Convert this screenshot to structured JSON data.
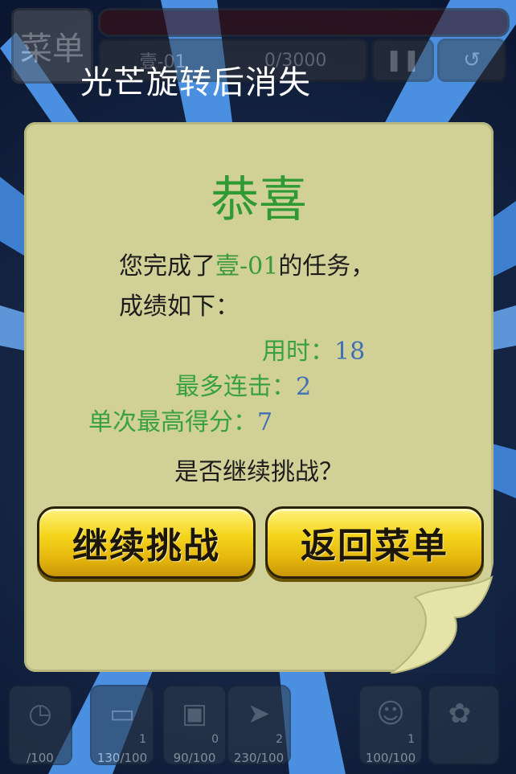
{
  "caption": "光芒旋转后消失",
  "hud": {
    "menu_label": "菜单",
    "level": "壹-01",
    "progress": "0/3000",
    "pause_icon": "pause-icon",
    "restart_icon": "restart-icon",
    "sound_icon": "sound-icon"
  },
  "dialog": {
    "title": "恭喜",
    "line1_prefix": "您完成了",
    "level_name": "壹-01",
    "line1_suffix": "的任务，",
    "line2": "成绩如下：",
    "stats": [
      {
        "label": "用时：",
        "value": "18"
      },
      {
        "label": "最多连击：",
        "value": "2"
      },
      {
        "label": "单次最高得分：",
        "value": "7"
      }
    ],
    "question": "是否继续挑战？",
    "continue_label": "继续挑战",
    "menu_label": "返回菜单"
  },
  "items": [
    {
      "icon": "clock-icon",
      "count": "",
      "caption": "/100"
    },
    {
      "icon": "cassette-icon",
      "count": "1",
      "caption": "130/100"
    },
    {
      "icon": "tv-icon",
      "count": "0",
      "caption": "90/100"
    },
    {
      "icon": "paper-plane-icon",
      "count": "2",
      "caption": "230/100"
    },
    {
      "icon": "mascot-icon",
      "count": "1",
      "caption": "100/100"
    },
    {
      "icon": "flower-icon",
      "count": "",
      "caption": ""
    }
  ]
}
